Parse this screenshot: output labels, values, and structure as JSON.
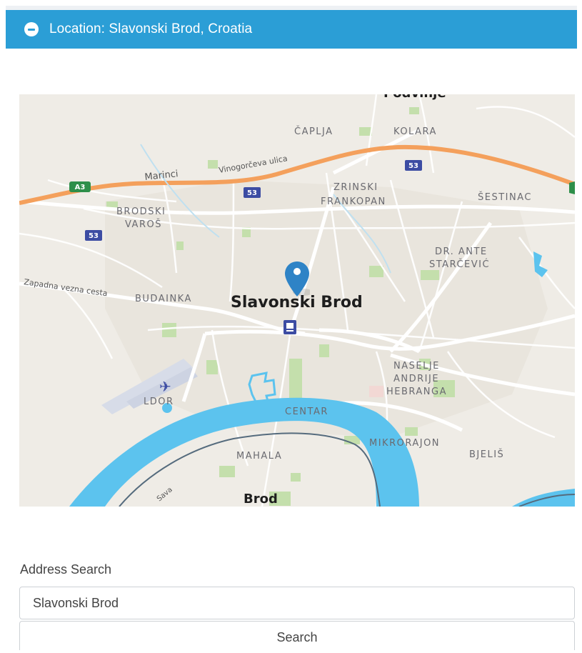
{
  "header": {
    "title": "Location: Slavonski Brod, Croatia",
    "icon": "minus-circle-icon"
  },
  "map": {
    "labels": {
      "podvinje": "Podvinje",
      "caplja": "ČAPLJA",
      "kolara": "KOLARA",
      "marinci": "Marinci",
      "vinogorceva": "Vinogorčeva ulica",
      "zrinski": "ZRINSKI",
      "frankopan": "FRANKOPAN",
      "sestinac": "ŠESTINAC",
      "brodski": "BRODSKI",
      "varos": "VAROŠ",
      "dr_ante": "DR. ANTE",
      "starcevic": "STARČEVIĆ",
      "zapadna": "Zapadna vezna cesta",
      "budainka": "BUDAINKA",
      "city": "Slavonski Brod",
      "naselje": "NASELJE",
      "andrije": "ANDRIJE",
      "hebranga": "HEBRANGA",
      "ldor": "LDOR",
      "centar": "CENTAR",
      "mikrorajon": "MIKRORAJON",
      "bjelis": "BJELIŠ",
      "mahala": "MAHALA",
      "sava": "Sava",
      "brod": "Brod"
    },
    "shields": {
      "a3": "A3",
      "r53": "53"
    },
    "colors": {
      "water": "#5cc3ee",
      "motorway": "#f4a05c",
      "park": "#b9dca0",
      "marker": "#2e83c6"
    }
  },
  "search": {
    "label": "Address Search",
    "value": "Slavonski Brod",
    "button_label": "Search"
  }
}
